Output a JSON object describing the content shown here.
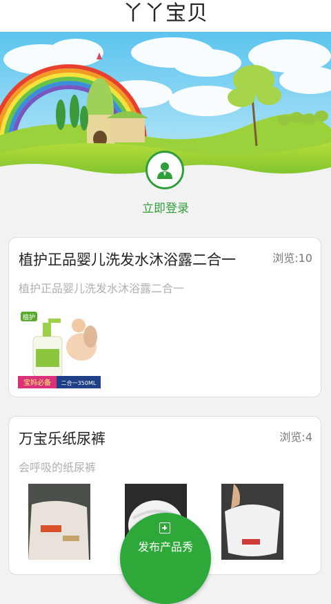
{
  "header": {
    "title": "丫丫宝贝"
  },
  "login": {
    "label": "立即登录",
    "icon": "user-icon"
  },
  "products": [
    {
      "title": "植护正品婴儿洗发水沐浴露二合一",
      "views": "浏览:10",
      "description": "植护正品婴儿洗发水沐浴露二合一",
      "image_texts": {
        "brand": "植护",
        "tag": "宝妈必备",
        "spec": "二合一350ML"
      }
    },
    {
      "title": "万宝乐纸尿裤",
      "views": "浏览:4",
      "description": "会呼吸的纸尿裤"
    }
  ],
  "fab": {
    "label": "发布产品秀",
    "icon": "plus-square-icon"
  },
  "colors": {
    "accent": "#2fa83a",
    "background": "#f2f2f2",
    "header": "#ffffff"
  }
}
